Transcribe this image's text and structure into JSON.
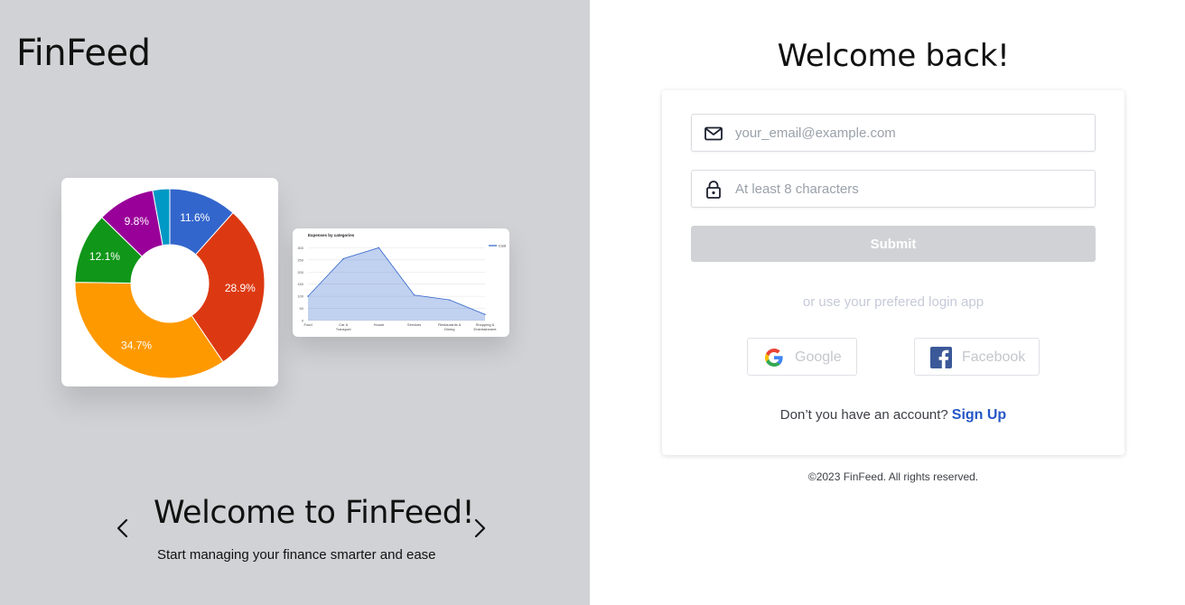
{
  "brand": {
    "logo_text": "FinFeed"
  },
  "carousel": {
    "title": "Welcome to FinFeed!",
    "subtitle": "Start managing your finance smarter and ease",
    "prev_icon": "chevron-left-icon",
    "next_icon": "chevron-right-icon"
  },
  "chart_data": [
    {
      "type": "pie",
      "style": "donut",
      "slices": [
        {
          "label": "11.6%",
          "value": 11.6,
          "color": "#3366cc"
        },
        {
          "label": "28.9%",
          "value": 28.9,
          "color": "#dc3912"
        },
        {
          "label": "34.7%",
          "value": 34.7,
          "color": "#ff9900"
        },
        {
          "label": "12.1%",
          "value": 12.1,
          "color": "#109618"
        },
        {
          "label": "9.8%",
          "value": 9.8,
          "color": "#990099"
        },
        {
          "label": "",
          "value": 2.9,
          "color": "#0099c6"
        }
      ]
    },
    {
      "type": "area",
      "title": "Expenses by categories",
      "categories": [
        "Food",
        "Car & Transport",
        "House",
        "Services",
        "Restaurants & Dining",
        "Shopping & Entertainment"
      ],
      "series": [
        {
          "name": "Cost",
          "values": [
            100,
            255,
            300,
            105,
            85,
            25
          ],
          "color": "#3366cc"
        }
      ],
      "yticks": [
        0,
        50,
        100,
        150,
        200,
        250,
        300
      ],
      "ylim": [
        0,
        320
      ],
      "grid": true,
      "legend": "right"
    }
  ],
  "login": {
    "heading": "Welcome back!",
    "email_placeholder": "your_email@example.com",
    "email_icon": "mail-icon",
    "password_placeholder": "At least 8 characters",
    "password_icon": "lock-icon",
    "submit_label": "Submit",
    "alt_text": "or use your prefered login app",
    "google_label": "Google",
    "facebook_label": "Facebook",
    "signup_prompt": "Don’t you have an account?",
    "signup_link": "Sign Up",
    "colors": {
      "link": "#2456c6",
      "submit_disabled": "#d1d2d5",
      "panel": "#d1d2d5"
    }
  },
  "footer": {
    "text": "©2023 FinFeed. All rights reserved."
  }
}
